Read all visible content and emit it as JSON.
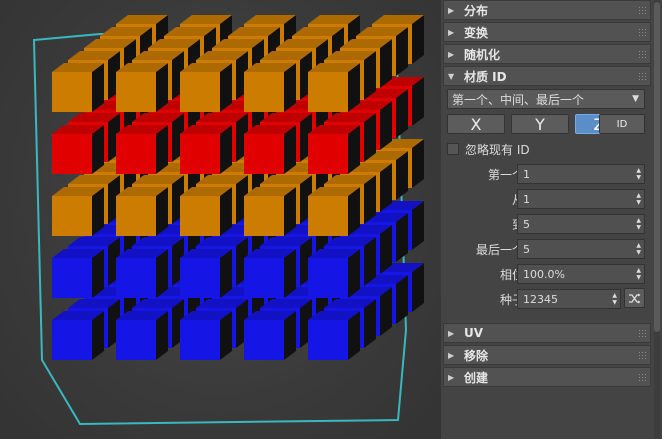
{
  "colors": {
    "orange": "#cc7d00",
    "red": "#e00000",
    "blue": "#1515e6",
    "outline": "#39d8e0",
    "active_axis": "#5b8ec9"
  },
  "viewport": {
    "layers": [
      "blue",
      "blue",
      "orange",
      "red",
      "orange"
    ]
  },
  "panel": {
    "rollouts_top": [
      {
        "label": "分布",
        "state": "collapsed"
      },
      {
        "label": "变换",
        "state": "collapsed"
      },
      {
        "label": "随机化",
        "state": "collapsed"
      }
    ],
    "material": {
      "title": "材质 ID",
      "mode": "第一个、中间、最后一个",
      "axes": [
        "X",
        "Y",
        "Z",
        "ID"
      ],
      "active_axis": "Z",
      "ignore_existing": "忽略现有 ID",
      "fields": [
        {
          "label": "第一个",
          "value": "1"
        },
        {
          "label": "从",
          "value": "1"
        },
        {
          "label": "到",
          "value": "5"
        },
        {
          "label": "最后一个",
          "value": "5"
        },
        {
          "label": "相位",
          "value": "100.0%"
        },
        {
          "label": "种子",
          "value": "12345"
        }
      ]
    },
    "rollouts_bottom": [
      {
        "label": "UV",
        "state": "collapsed"
      },
      {
        "label": "移除",
        "state": "collapsed"
      },
      {
        "label": "创建",
        "state": "collapsed"
      }
    ]
  }
}
